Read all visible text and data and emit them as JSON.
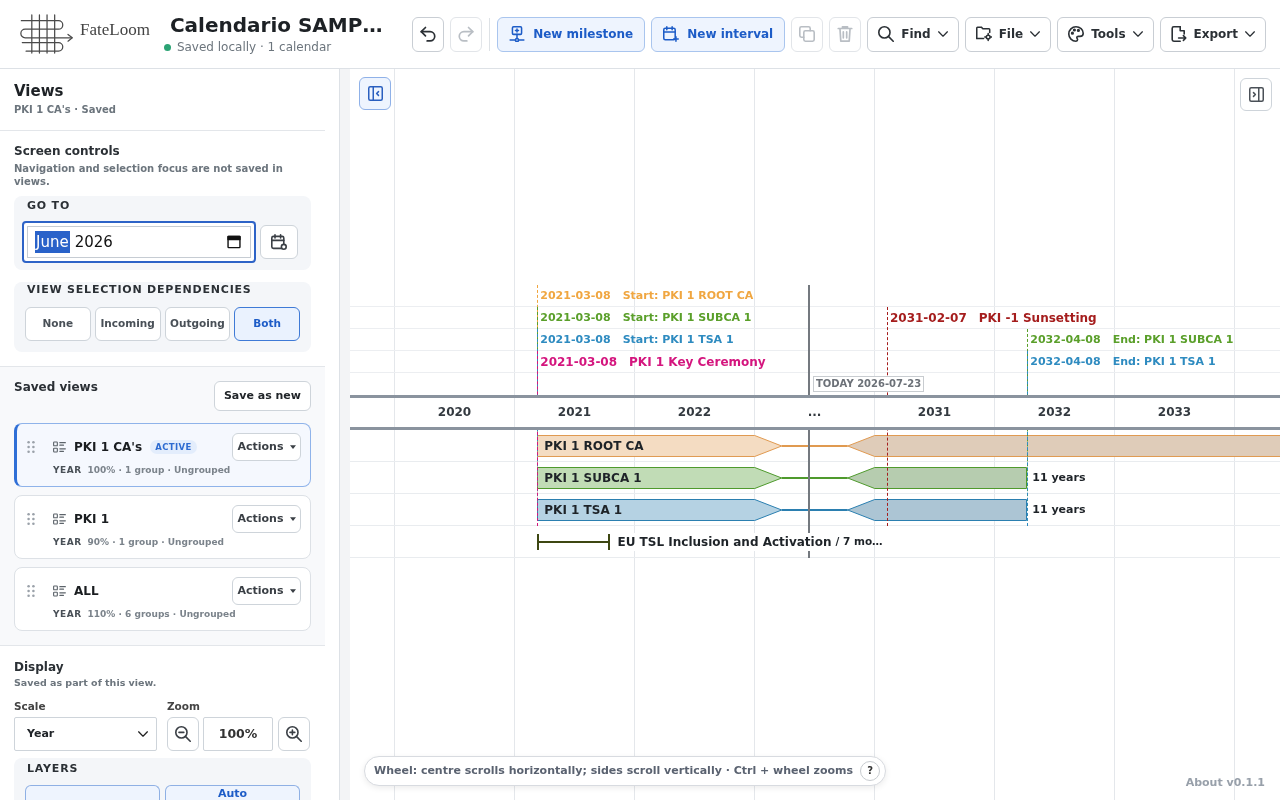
{
  "header": {
    "brand": "FateLoom",
    "title": "Calendario SAMP…",
    "status": "Saved locally · 1 calendar"
  },
  "toolbar": {
    "history": [
      {
        "disabled": false
      },
      {
        "disabled": true
      }
    ],
    "create": [
      {
        "label": "New milestone"
      },
      {
        "label": "New interval"
      }
    ],
    "edit": [
      {
        "disabled": true
      },
      {
        "disabled": true
      }
    ],
    "menus": [
      {
        "label": "Find"
      },
      {
        "label": "File"
      },
      {
        "label": "Tools"
      },
      {
        "label": "Export"
      }
    ]
  },
  "sidebar": {
    "title": "Views",
    "subtitle": "PKI 1 CA's · Saved",
    "screen_controls": {
      "title": "Screen controls",
      "note": "Navigation and selection focus are not saved in views.",
      "go_to": {
        "heading": "GO TO",
        "month": "June",
        "year": "2026",
        "month_selected": true,
        "focused": true
      },
      "dependencies": {
        "heading": "VIEW SELECTION DEPENDENCIES",
        "options": [
          {
            "label": "None",
            "selected": false
          },
          {
            "label": "Incoming",
            "selected": false
          },
          {
            "label": "Outgoing",
            "selected": false
          },
          {
            "label": "Both",
            "selected": true
          }
        ]
      }
    },
    "saved_views": {
      "title": "Saved views",
      "save_button": "Save as new",
      "items": [
        {
          "name": "PKI 1 CA's",
          "badge": "ACTIVE",
          "selected": true,
          "scale": "YEAR",
          "summary": "100% · 1 group · Ungrouped",
          "actions": "Actions"
        },
        {
          "name": "PKI 1",
          "selected": false,
          "scale": "YEAR",
          "summary": "90% · 1 group · Ungrouped",
          "actions": "Actions"
        },
        {
          "name": "ALL",
          "selected": false,
          "scale": "YEAR",
          "summary": "110% · 6 groups · Ungrouped",
          "actions": "Actions"
        }
      ]
    },
    "display": {
      "title": "Display",
      "note": "Saved as part of this view.",
      "scale_label": "Scale",
      "scale_value": "Year",
      "zoom_label": "Zoom",
      "zoom_value": "100%",
      "layers": {
        "heading": "LAYERS",
        "options": [
          {
            "selected": true
          },
          {
            "label": "Auto",
            "selected": true
          }
        ]
      }
    }
  },
  "timeline": {
    "panel_toggles": [
      {
        "selected": true
      },
      {
        "selected": false
      }
    ],
    "lanes": [
      {
        "markers": [
          {
            "date": "2021-03-08",
            "title": "Start: PKI 1 ROOT CA",
            "color": "#f0a640",
            "kind": "boundary"
          }
        ]
      },
      {
        "markers": [
          {
            "date": "2021-03-08",
            "title": "Start: PKI 1 SUBCA 1",
            "color": "#5a9f2a",
            "kind": "boundary"
          },
          {
            "date": "2031-02-07",
            "title": "PKI -1 Sunsetting",
            "color": "#a51d1d",
            "kind": "milestone"
          }
        ]
      },
      {
        "markers": [
          {
            "date": "2021-03-08",
            "title": "Start: PKI 1 TSA 1",
            "color": "#2e8bc0",
            "kind": "boundary"
          },
          {
            "date": "2032-04-08",
            "title": "End: PKI 1 SUBCA 1",
            "color": "#5a9f2a",
            "kind": "boundary"
          }
        ]
      },
      {
        "markers": [
          {
            "date": "2021-03-08",
            "title": "PKI 1 Key Ceremony",
            "color": "#d4157e",
            "kind": "milestone"
          },
          {
            "date": "2032-04-08",
            "title": "End: PKI 1 TSA 1",
            "color": "#2e8bc0",
            "kind": "boundary"
          }
        ]
      }
    ],
    "today": {
      "label": "TODAY",
      "date": "2026-07-23"
    },
    "columns": [
      {
        "label": "2020",
        "kind": "year"
      },
      {
        "label": "2021",
        "kind": "year"
      },
      {
        "label": "2022",
        "kind": "year"
      },
      {
        "label": "...",
        "kind": "break"
      },
      {
        "label": "2031",
        "kind": "year"
      },
      {
        "label": "2032",
        "kind": "year"
      },
      {
        "label": "2033",
        "kind": "year"
      }
    ],
    "rows": [
      {
        "kind": "bar",
        "label": "PKI 1 ROOT CA",
        "color": "#e09a50"
      },
      {
        "kind": "bar",
        "label": "PKI 1 SUBCA 1",
        "duration": "11 years",
        "color": "#4f9a2d"
      },
      {
        "kind": "bar",
        "label": "PKI 1 TSA 1",
        "duration": "11 years",
        "color": "#2b7fb0"
      },
      {
        "kind": "bracket",
        "label": "EU TSL Inclusion and Activation",
        "note": "/ 7 mo…",
        "color": "#3d4712"
      }
    ],
    "hint": {
      "text": "Wheel: centre scrolls horizontally; sides scroll vertically · Ctrl + wheel zooms",
      "help": "?"
    },
    "about": "About v0.1.1"
  }
}
